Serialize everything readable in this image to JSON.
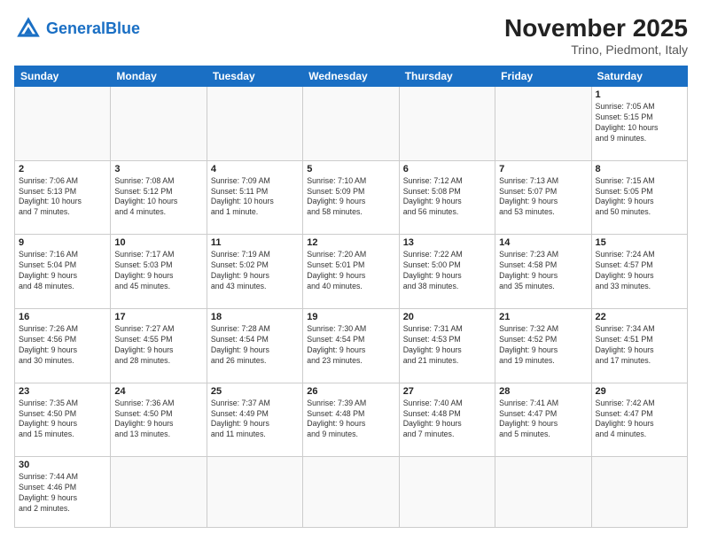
{
  "header": {
    "logo_general": "General",
    "logo_blue": "Blue",
    "month_title": "November 2025",
    "subtitle": "Trino, Piedmont, Italy"
  },
  "days_of_week": [
    "Sunday",
    "Monday",
    "Tuesday",
    "Wednesday",
    "Thursday",
    "Friday",
    "Saturday"
  ],
  "weeks": [
    [
      {
        "day": "",
        "info": ""
      },
      {
        "day": "",
        "info": ""
      },
      {
        "day": "",
        "info": ""
      },
      {
        "day": "",
        "info": ""
      },
      {
        "day": "",
        "info": ""
      },
      {
        "day": "",
        "info": ""
      },
      {
        "day": "1",
        "info": "Sunrise: 7:05 AM\nSunset: 5:15 PM\nDaylight: 10 hours\nand 9 minutes."
      }
    ],
    [
      {
        "day": "2",
        "info": "Sunrise: 7:06 AM\nSunset: 5:13 PM\nDaylight: 10 hours\nand 7 minutes."
      },
      {
        "day": "3",
        "info": "Sunrise: 7:08 AM\nSunset: 5:12 PM\nDaylight: 10 hours\nand 4 minutes."
      },
      {
        "day": "4",
        "info": "Sunrise: 7:09 AM\nSunset: 5:11 PM\nDaylight: 10 hours\nand 1 minute."
      },
      {
        "day": "5",
        "info": "Sunrise: 7:10 AM\nSunset: 5:09 PM\nDaylight: 9 hours\nand 58 minutes."
      },
      {
        "day": "6",
        "info": "Sunrise: 7:12 AM\nSunset: 5:08 PM\nDaylight: 9 hours\nand 56 minutes."
      },
      {
        "day": "7",
        "info": "Sunrise: 7:13 AM\nSunset: 5:07 PM\nDaylight: 9 hours\nand 53 minutes."
      },
      {
        "day": "8",
        "info": "Sunrise: 7:15 AM\nSunset: 5:05 PM\nDaylight: 9 hours\nand 50 minutes."
      }
    ],
    [
      {
        "day": "9",
        "info": "Sunrise: 7:16 AM\nSunset: 5:04 PM\nDaylight: 9 hours\nand 48 minutes."
      },
      {
        "day": "10",
        "info": "Sunrise: 7:17 AM\nSunset: 5:03 PM\nDaylight: 9 hours\nand 45 minutes."
      },
      {
        "day": "11",
        "info": "Sunrise: 7:19 AM\nSunset: 5:02 PM\nDaylight: 9 hours\nand 43 minutes."
      },
      {
        "day": "12",
        "info": "Sunrise: 7:20 AM\nSunset: 5:01 PM\nDaylight: 9 hours\nand 40 minutes."
      },
      {
        "day": "13",
        "info": "Sunrise: 7:22 AM\nSunset: 5:00 PM\nDaylight: 9 hours\nand 38 minutes."
      },
      {
        "day": "14",
        "info": "Sunrise: 7:23 AM\nSunset: 4:58 PM\nDaylight: 9 hours\nand 35 minutes."
      },
      {
        "day": "15",
        "info": "Sunrise: 7:24 AM\nSunset: 4:57 PM\nDaylight: 9 hours\nand 33 minutes."
      }
    ],
    [
      {
        "day": "16",
        "info": "Sunrise: 7:26 AM\nSunset: 4:56 PM\nDaylight: 9 hours\nand 30 minutes."
      },
      {
        "day": "17",
        "info": "Sunrise: 7:27 AM\nSunset: 4:55 PM\nDaylight: 9 hours\nand 28 minutes."
      },
      {
        "day": "18",
        "info": "Sunrise: 7:28 AM\nSunset: 4:54 PM\nDaylight: 9 hours\nand 26 minutes."
      },
      {
        "day": "19",
        "info": "Sunrise: 7:30 AM\nSunset: 4:54 PM\nDaylight: 9 hours\nand 23 minutes."
      },
      {
        "day": "20",
        "info": "Sunrise: 7:31 AM\nSunset: 4:53 PM\nDaylight: 9 hours\nand 21 minutes."
      },
      {
        "day": "21",
        "info": "Sunrise: 7:32 AM\nSunset: 4:52 PM\nDaylight: 9 hours\nand 19 minutes."
      },
      {
        "day": "22",
        "info": "Sunrise: 7:34 AM\nSunset: 4:51 PM\nDaylight: 9 hours\nand 17 minutes."
      }
    ],
    [
      {
        "day": "23",
        "info": "Sunrise: 7:35 AM\nSunset: 4:50 PM\nDaylight: 9 hours\nand 15 minutes."
      },
      {
        "day": "24",
        "info": "Sunrise: 7:36 AM\nSunset: 4:50 PM\nDaylight: 9 hours\nand 13 minutes."
      },
      {
        "day": "25",
        "info": "Sunrise: 7:37 AM\nSunset: 4:49 PM\nDaylight: 9 hours\nand 11 minutes."
      },
      {
        "day": "26",
        "info": "Sunrise: 7:39 AM\nSunset: 4:48 PM\nDaylight: 9 hours\nand 9 minutes."
      },
      {
        "day": "27",
        "info": "Sunrise: 7:40 AM\nSunset: 4:48 PM\nDaylight: 9 hours\nand 7 minutes."
      },
      {
        "day": "28",
        "info": "Sunrise: 7:41 AM\nSunset: 4:47 PM\nDaylight: 9 hours\nand 5 minutes."
      },
      {
        "day": "29",
        "info": "Sunrise: 7:42 AM\nSunset: 4:47 PM\nDaylight: 9 hours\nand 4 minutes."
      }
    ],
    [
      {
        "day": "30",
        "info": "Sunrise: 7:44 AM\nSunset: 4:46 PM\nDaylight: 9 hours\nand 2 minutes."
      },
      {
        "day": "",
        "info": ""
      },
      {
        "day": "",
        "info": ""
      },
      {
        "day": "",
        "info": ""
      },
      {
        "day": "",
        "info": ""
      },
      {
        "day": "",
        "info": ""
      },
      {
        "day": "",
        "info": ""
      }
    ]
  ]
}
